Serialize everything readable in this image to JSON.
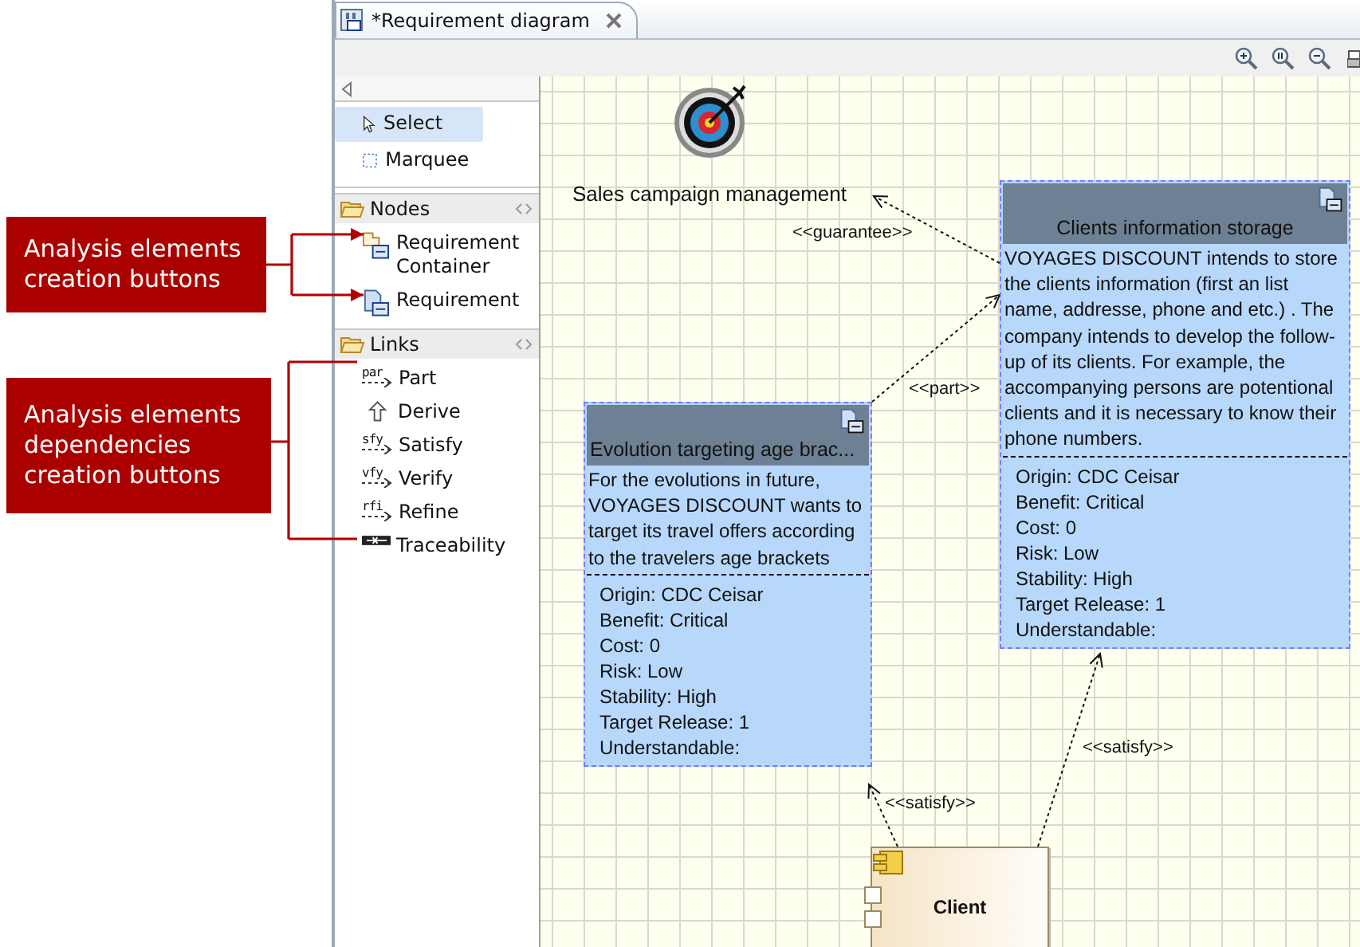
{
  "callouts": [
    {
      "text": "Analysis elements creation buttons"
    },
    {
      "text": "Analysis elements dependencies creation buttons"
    }
  ],
  "editor_tab": {
    "title": "*Requirement diagram"
  },
  "palette": {
    "sections": [
      {
        "kind": "tools",
        "items": [
          {
            "kind": "select",
            "label": "Select",
            "selected": true
          },
          {
            "kind": "marquee",
            "label": "Marquee",
            "selected": false
          }
        ]
      },
      {
        "kind": "drawer",
        "title": "Nodes",
        "items": [
          {
            "kind": "container",
            "label": "Requirement Container",
            "selected": false
          },
          {
            "kind": "requirement",
            "label": "Requirement",
            "selected": false
          }
        ]
      },
      {
        "kind": "drawer",
        "title": "Links",
        "items": [
          {
            "kind": "link",
            "icon_text": "par",
            "label": "Part",
            "selected": false
          },
          {
            "kind": "derive",
            "label": "Derive",
            "selected": false
          },
          {
            "kind": "link",
            "icon_text": "sfy",
            "label": "Satisfy",
            "selected": false
          },
          {
            "kind": "link",
            "icon_text": "vfy",
            "label": "Verify",
            "selected": false
          },
          {
            "kind": "link",
            "icon_text": "rfi",
            "label": "Refine",
            "selected": false
          },
          {
            "kind": "trace",
            "label": "Traceability",
            "selected": false
          }
        ]
      }
    ]
  },
  "diagram": {
    "goal": {
      "label": "Sales campaign management"
    },
    "requirements": [
      {
        "title": "Clients information storage",
        "description": "VOYAGES DISCOUNT intends to store the clients information (first an list name, addresse, phone and etc.) . The company intends to develop the follow-up of its clients. For example, the accompanying persons are potentional clients and it is necessary to know their phone numbers.",
        "attributes": [
          "Origin: CDC Ceisar",
          "Benefit: Critical",
          "Cost: 0",
          "Risk: Low",
          "Stability: High",
          "Target Release: 1",
          "Understandable:"
        ]
      },
      {
        "title": "Evolution targeting age brac...",
        "description": "For the evolutions in future, VOYAGES DISCOUNT wants to target its travel offers according to the travelers age brackets",
        "attributes": [
          "Origin: CDC Ceisar",
          "Benefit: Critical",
          "Cost: 0",
          "Risk: Low",
          "Stability: High",
          "Target Release: 1",
          "Understandable:"
        ]
      }
    ],
    "component": {
      "name": "Client"
    },
    "links": [
      {
        "stereotype": "<<guarantee>>"
      },
      {
        "stereotype": "<<part>>"
      },
      {
        "stereotype": "<<satisfy>>"
      },
      {
        "stereotype": "<<satisfy>>"
      }
    ]
  }
}
